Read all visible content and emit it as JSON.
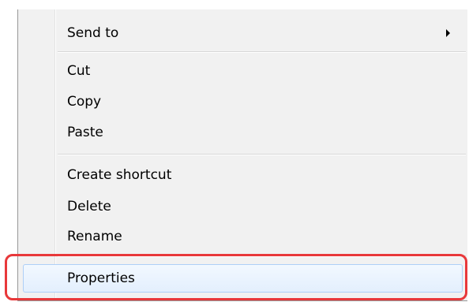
{
  "context_menu": {
    "items": [
      {
        "label": "Send to",
        "submenu": true
      },
      {
        "label": "Cut"
      },
      {
        "label": "Copy"
      },
      {
        "label": "Paste"
      },
      {
        "label": "Create shortcut"
      },
      {
        "label": "Delete"
      },
      {
        "label": "Rename"
      },
      {
        "label": "Properties",
        "highlighted": true
      }
    ]
  },
  "colors": {
    "menu_background": "#f1f1f1",
    "hover_border": "#aecff7",
    "annotation_red": "#e8383a"
  }
}
